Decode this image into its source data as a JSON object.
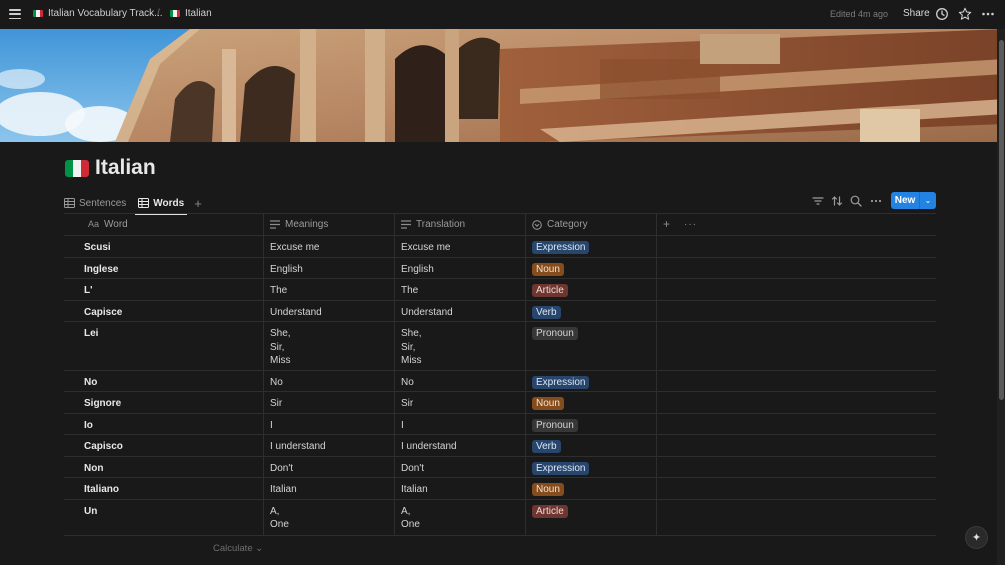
{
  "breadcrumb": {
    "parent": "Italian Vocabulary Track...",
    "separator": "/",
    "current": "Italian"
  },
  "topbar": {
    "edited": "Edited 4m ago",
    "share": "Share"
  },
  "page": {
    "title": "Italian"
  },
  "tabs": [
    {
      "label": "Sentences",
      "active": false
    },
    {
      "label": "Words",
      "active": true
    }
  ],
  "toolbar": {
    "new_label": "New"
  },
  "columns": {
    "word": "Word",
    "word_icon": "Aa",
    "meanings": "Meanings",
    "translation": "Translation",
    "category": "Category"
  },
  "rows": [
    {
      "word": "Scusi",
      "meanings": "Excuse me",
      "translation": "Excuse me",
      "category": "Expression"
    },
    {
      "word": "Inglese",
      "meanings": "English",
      "translation": "English",
      "category": "Noun"
    },
    {
      "word": "L'",
      "meanings": "The",
      "translation": "The",
      "category": "Article"
    },
    {
      "word": "Capisce",
      "meanings": "Understand",
      "translation": "Understand",
      "category": "Verb"
    },
    {
      "word": "Lei",
      "meanings": "She,\nSir,\nMiss",
      "translation": "She,\nSir,\nMiss",
      "category": "Pronoun"
    },
    {
      "word": "No",
      "meanings": "No",
      "translation": "No",
      "category": "Expression"
    },
    {
      "word": "Signore",
      "meanings": "Sir",
      "translation": "Sir",
      "category": "Noun"
    },
    {
      "word": "Io",
      "meanings": "I",
      "translation": "I",
      "category": "Pronoun"
    },
    {
      "word": "Capisco",
      "meanings": "I understand",
      "translation": "I understand",
      "category": "Verb"
    },
    {
      "word": "Non",
      "meanings": "Don't",
      "translation": "Don't",
      "category": "Expression"
    },
    {
      "word": "Italiano",
      "meanings": "Italian",
      "translation": "Italian",
      "category": "Noun"
    },
    {
      "word": "Un",
      "meanings": "A,\nOne",
      "translation": "A,\nOne",
      "category": "Article"
    }
  ],
  "category_colors": {
    "Expression": {
      "bg": "#28456c",
      "fg": "#dbe8f7"
    },
    "Noun": {
      "bg": "#854c1d",
      "fg": "#f5e2cf"
    },
    "Article": {
      "bg": "#6e3630",
      "fg": "#f3d8d4"
    },
    "Verb": {
      "bg": "#28456c",
      "fg": "#dbe8f7"
    },
    "Pronoun": {
      "bg": "#373737",
      "fg": "#d4d4d4"
    }
  },
  "footer": {
    "calculate": "Calculate"
  },
  "colors": {
    "accent": "#2383e2",
    "background": "#191919"
  }
}
